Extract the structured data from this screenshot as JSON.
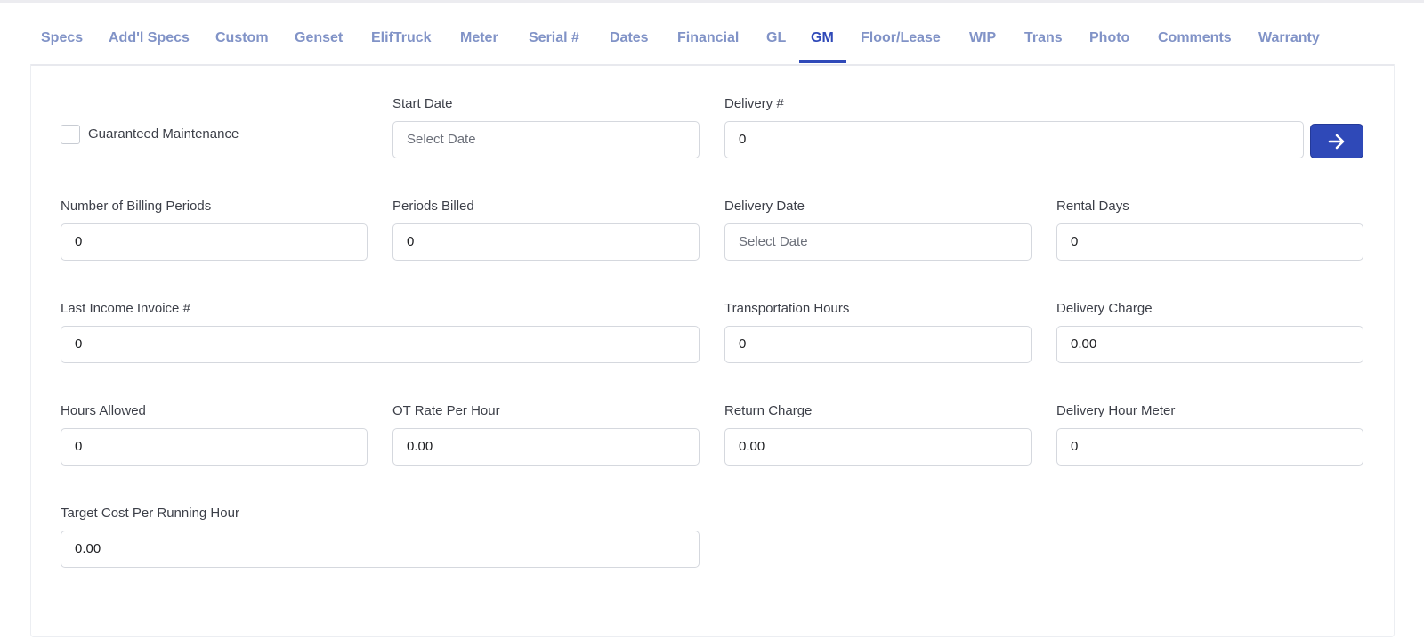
{
  "tabs": [
    {
      "label": "Specs"
    },
    {
      "label": "Add'l Specs"
    },
    {
      "label": "Custom"
    },
    {
      "label": "Genset"
    },
    {
      "label": "ElifTruck"
    },
    {
      "label": "Meter"
    },
    {
      "label": "Serial #"
    },
    {
      "label": "Dates"
    },
    {
      "label": "Financial"
    },
    {
      "label": "GL"
    },
    {
      "label": "GM"
    },
    {
      "label": "Floor/Lease"
    },
    {
      "label": "WIP"
    },
    {
      "label": "Trans"
    },
    {
      "label": "Photo"
    },
    {
      "label": "Comments"
    },
    {
      "label": "Warranty"
    }
  ],
  "active_tab": "GM",
  "form": {
    "guaranteed_maintenance": {
      "label": "Guaranteed Maintenance",
      "checked": false
    },
    "start_date": {
      "label": "Start Date",
      "placeholder": "Select Date"
    },
    "delivery_number": {
      "label": "Delivery #",
      "value": "0"
    },
    "go_button": {
      "icon": "arrow-right-icon"
    },
    "number_of_billing_periods": {
      "label": "Number of Billing Periods",
      "value": "0"
    },
    "periods_billed": {
      "label": "Periods Billed",
      "value": "0"
    },
    "delivery_date": {
      "label": "Delivery Date",
      "placeholder": "Select Date"
    },
    "rental_days": {
      "label": "Rental Days",
      "value": "0"
    },
    "last_income_invoice": {
      "label": "Last Income Invoice #",
      "value": "0"
    },
    "transportation_hours": {
      "label": "Transportation Hours",
      "value": "0"
    },
    "delivery_charge": {
      "label": "Delivery Charge",
      "value": "0.00"
    },
    "hours_allowed": {
      "label": "Hours Allowed",
      "value": "0"
    },
    "ot_rate_per_hour": {
      "label": "OT Rate Per Hour",
      "value": "0.00"
    },
    "return_charge": {
      "label": "Return Charge",
      "value": "0.00"
    },
    "delivery_hour_meter": {
      "label": "Delivery Hour Meter",
      "value": "0"
    },
    "target_cost_per_running_hour": {
      "label": "Target Cost Per Running Hour",
      "value": "0.00"
    }
  },
  "colors": {
    "accent": "#2f49b8",
    "tab_inactive": "#8193c7",
    "border": "#d5d8de"
  }
}
